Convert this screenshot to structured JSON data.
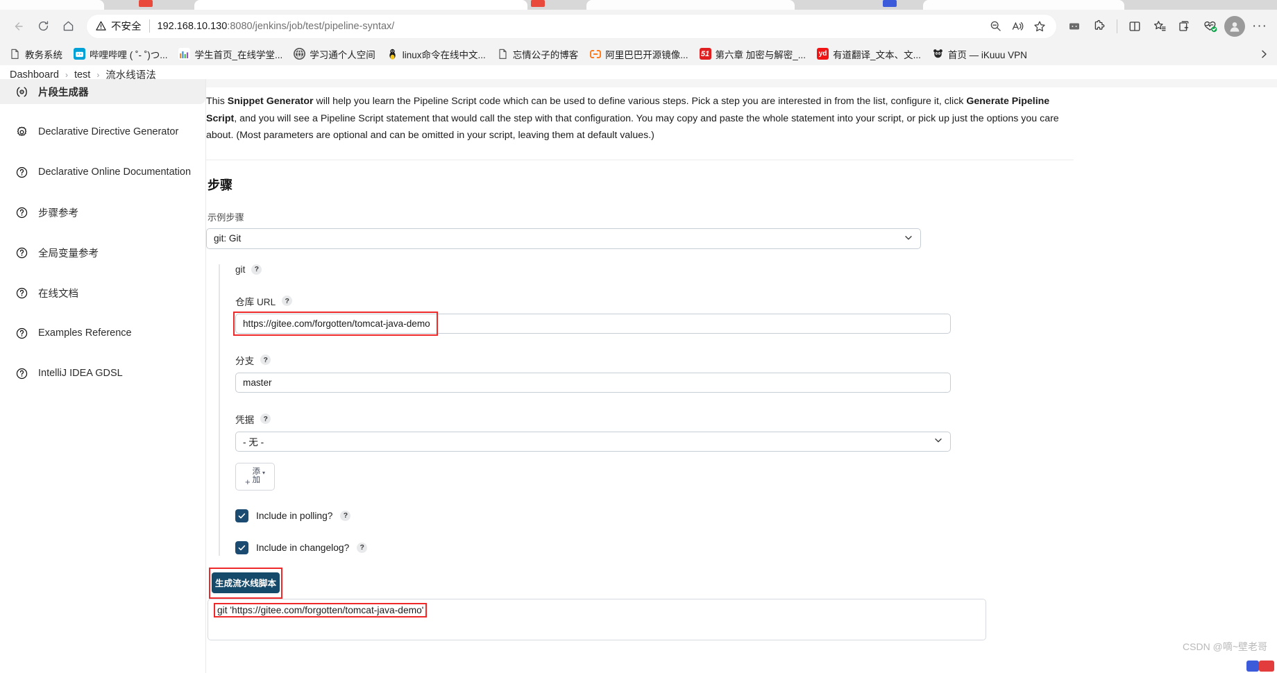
{
  "browser": {
    "nav": {
      "back_icon": "arrow-left-icon",
      "reload_icon": "reload-icon",
      "home_icon": "home-icon"
    },
    "omnibox": {
      "security_label": "不安全",
      "warning_icon": "warning-triangle-icon",
      "url_host": "192.168.10.130",
      "url_rest": ":8080/jenkins/job/test/pipeline-syntax/",
      "zoom_icon": "zoom-search-icon",
      "read_aloud_icon": "read-aloud-icon",
      "favorite_icon": "star-icon"
    },
    "toolbar": [
      {
        "name": "split-screen-icon"
      },
      {
        "name": "extensions-icon"
      },
      {
        "name": "browser-essentials-icon"
      },
      {
        "name": "favorites-list-icon"
      },
      {
        "name": "collections-icon"
      },
      {
        "name": "performance-icon"
      },
      {
        "name": "profile-avatar"
      },
      {
        "name": "more-options-icon"
      }
    ],
    "bookmarks": [
      {
        "label": "教务系统",
        "icon": "page-icon",
        "color": "#ffffff",
        "text": ""
      },
      {
        "label": "哔哩哔哩 ( ˚- ˚)つ...",
        "icon": "bilibili-icon",
        "color": "#00a1d6",
        "text": ""
      },
      {
        "label": "学生首页_在线学堂...",
        "icon": "chart-icon",
        "color": "#ffffff",
        "text": ""
      },
      {
        "label": "学习通个人空间",
        "icon": "globe-icon",
        "color": "#555555",
        "text": ""
      },
      {
        "label": "linux命令在线中文...",
        "icon": "tux-icon",
        "color": "#ffffff",
        "text": ""
      },
      {
        "label": "忘情公子的博客",
        "icon": "page-icon",
        "color": "#ffffff",
        "text": ""
      },
      {
        "label": "阿里巴巴开源镜像...",
        "icon": "aliyun-icon",
        "color": "#ff6a00",
        "text": ""
      },
      {
        "label": "第六章 加密与解密_...",
        "icon": "51cto-icon",
        "color": "#e02020",
        "text": "51"
      },
      {
        "label": "有道翻译_文本、文...",
        "icon": "youdao-icon",
        "color": "#f01414",
        "text": "yd"
      },
      {
        "label": "首页 — iKuuu VPN",
        "icon": "panda-icon",
        "color": "#2b2b2b",
        "text": ""
      }
    ],
    "bookmark_overflow_icon": "chevron-right-icon"
  },
  "breadcrumb": {
    "items": [
      "Dashboard",
      "test",
      "流水线语法"
    ],
    "separator": "›"
  },
  "sidebar": {
    "items": [
      {
        "label": "片段生成器",
        "icon": "gear-brackets-icon",
        "active": true
      },
      {
        "label": "Declarative Directive Generator",
        "icon": "gear-icon",
        "active": false
      },
      {
        "label": "Declarative Online Documentation",
        "icon": "help-circle-icon",
        "active": false
      },
      {
        "label": "步骤参考",
        "icon": "help-circle-icon",
        "active": false
      },
      {
        "label": "全局变量参考",
        "icon": "help-circle-icon",
        "active": false
      },
      {
        "label": "在线文档",
        "icon": "help-circle-icon",
        "active": false
      },
      {
        "label": "Examples Reference",
        "icon": "help-circle-icon",
        "active": false
      },
      {
        "label": "IntelliJ IDEA GDSL",
        "icon": "help-circle-icon",
        "active": false
      }
    ]
  },
  "main": {
    "intro": {
      "p1": "This ",
      "b1": "Snippet Generator",
      "p2": " will help you learn the Pipeline Script code which can be used to define various steps. Pick a step you are interested in from the list, configure it, click ",
      "b2": "Generate Pipeline Script",
      "p3": ", and you will see a Pipeline Script statement that would call the step with that configuration. You may copy and paste the whole statement into your script, or pick up just the options you care about. (Most parameters are optional and can be omitted in your script, leaving them at default values.)"
    },
    "section_title": "步骤",
    "sample_step": {
      "label": "示例步骤",
      "value": "git: Git",
      "chevron_icon": "chevron-down-icon"
    },
    "step_block": {
      "title": "git",
      "help_glyph": "?",
      "fields": [
        {
          "label": "仓库 URL",
          "type": "text",
          "value": "https://gitee.com/forgotten/tomcat-java-demo",
          "highlighted": true
        },
        {
          "label": "分支",
          "type": "text",
          "value": "master",
          "highlighted": false
        },
        {
          "label": "凭据",
          "type": "select",
          "value": "- 无 -",
          "highlighted": false
        }
      ],
      "add_button": {
        "plus": "+",
        "line1": "添",
        "line2": "加",
        "caret": "▾",
        "name": "add-credentials-button"
      },
      "checkboxes": [
        {
          "label": "Include in polling?",
          "checked": true
        },
        {
          "label": "Include in changelog?",
          "checked": true
        }
      ]
    },
    "generate_button": {
      "label": "生成流水线脚本",
      "highlighted": true
    },
    "output": {
      "text": "git 'https://gitee.com/forgotten/tomcat-java-demo'",
      "highlighted": true
    }
  },
  "watermark": {
    "text": "CSDN @嘀~壁老哥"
  },
  "colors": {
    "accent": "#154a6b",
    "checkbox": "#1c4b72",
    "highlight_red": "#ef2929",
    "chrome_bg": "#f3f3f3"
  }
}
